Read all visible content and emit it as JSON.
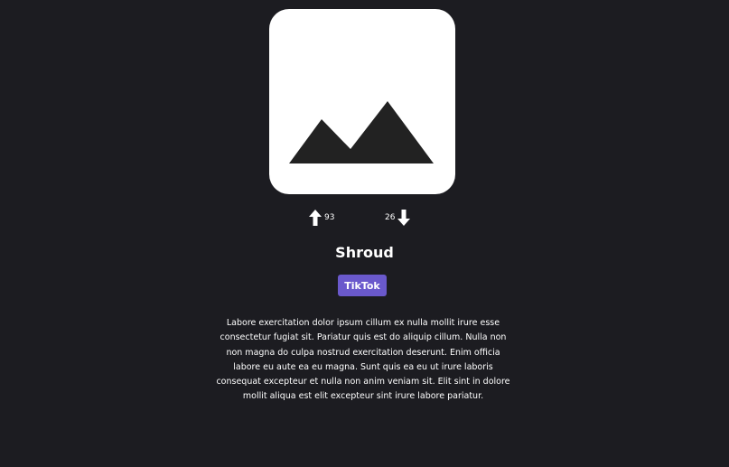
{
  "card": {
    "image_icon": "image-placeholder-icon",
    "upvotes": "93",
    "downvotes": "26",
    "name": "Shroud",
    "platform_label": "TikTok",
    "description": "Labore exercitation dolor ipsum cillum ex nulla mollit irure esse consectetur fugiat sit. Pariatur quis est do aliquip cillum. Nulla non non magna do culpa nostrud exercitation deserunt. Enim officia labore eu aute ea eu magna. Sunt quis ea eu ut irure laboris consequat excepteur et nulla non anim veniam sit. Elit sint in dolore mollit aliqua est elit excepteur sint irure labore pariatur."
  },
  "colors": {
    "background": "#1c1c21",
    "platform_badge": "#6a59cc",
    "image_bg": "#ffffff",
    "image_icon": "#222222"
  }
}
